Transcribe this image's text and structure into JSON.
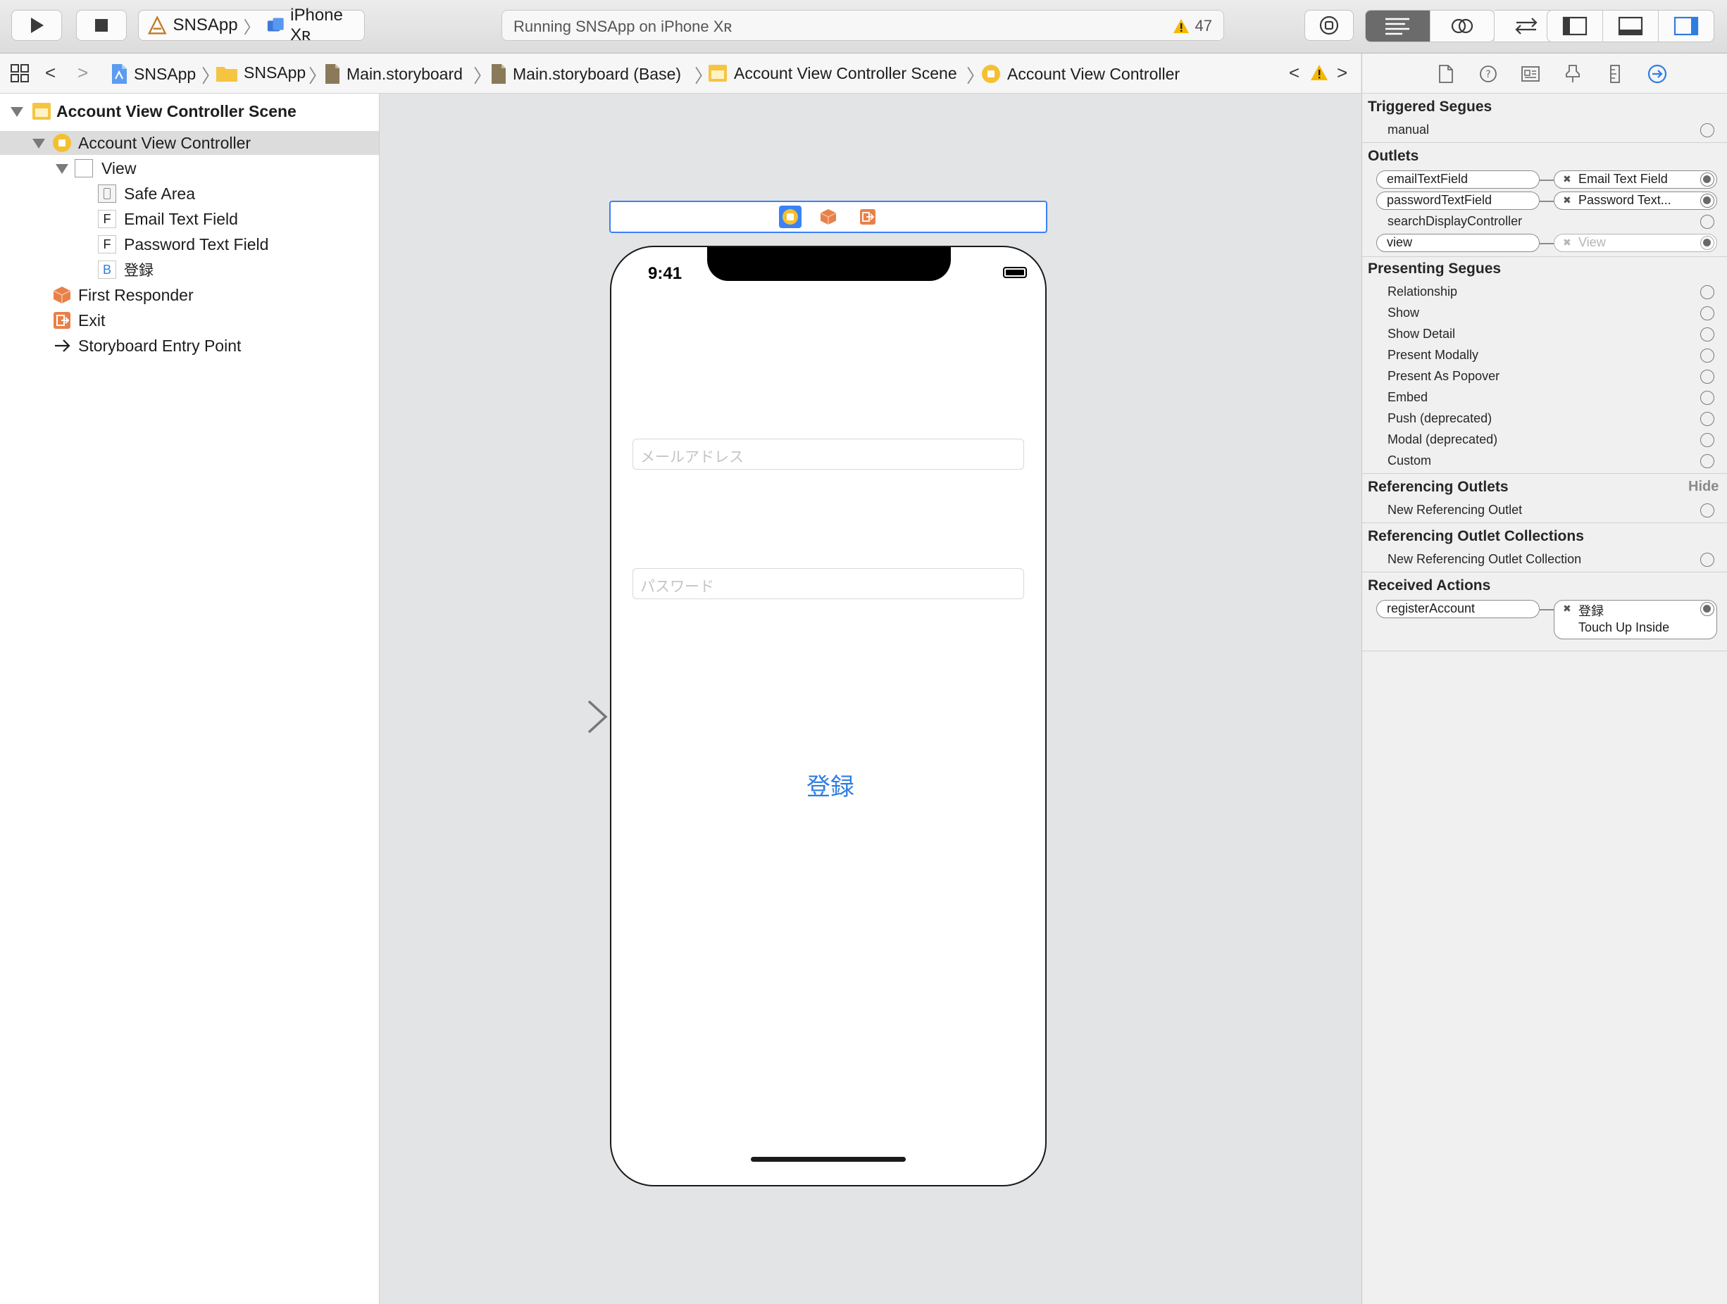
{
  "toolbar": {
    "scheme_app": "SNSApp",
    "scheme_device": "iPhone Xʀ",
    "status_text": "Running SNSApp on iPhone Xʀ",
    "warning_count": "47"
  },
  "jumpbar": {
    "items": [
      "SNSApp",
      "SNSApp",
      "Main.storyboard",
      "Main.storyboard (Base)",
      "Account View Controller Scene",
      "Account View Controller"
    ]
  },
  "outline": {
    "scene": "Account View Controller Scene",
    "controller": "Account View Controller",
    "view": "View",
    "safe_area": "Safe Area",
    "email_field": "Email Text Field",
    "password_field": "Password Text Field",
    "button": "登録",
    "first_responder": "First Responder",
    "exit": "Exit",
    "entry_point": "Storyboard Entry Point",
    "icon_f": "F",
    "icon_b": "B"
  },
  "device": {
    "time": "9:41",
    "email_placeholder": "メールアドレス",
    "password_placeholder": "パスワード",
    "button_label": "登録"
  },
  "inspector": {
    "triggered_segues": {
      "title": "Triggered Segues",
      "items": [
        "manual"
      ]
    },
    "outlets": {
      "title": "Outlets",
      "items": [
        {
          "name": "emailTextField",
          "target": "Email Text Field"
        },
        {
          "name": "passwordTextField",
          "target": "Password Text..."
        },
        {
          "name": "searchDisplayController",
          "target": ""
        },
        {
          "name": "view",
          "target": "View"
        }
      ]
    },
    "presenting_segues": {
      "title": "Presenting Segues",
      "items": [
        "Relationship",
        "Show",
        "Show Detail",
        "Present Modally",
        "Present As Popover",
        "Embed",
        "Push (deprecated)",
        "Modal (deprecated)",
        "Custom"
      ]
    },
    "referencing_outlets": {
      "title": "Referencing Outlets",
      "hide": "Hide",
      "items": [
        "New Referencing Outlet"
      ]
    },
    "referencing_outlet_collections": {
      "title": "Referencing Outlet Collections",
      "items": [
        "New Referencing Outlet Collection"
      ]
    },
    "received_actions": {
      "title": "Received Actions",
      "action": "registerAccount",
      "target": "登録",
      "event": "Touch Up Inside"
    }
  },
  "colors": {
    "accent": "#2f7de1",
    "selection_blue": "#3a82f6",
    "warning": "#f5b800",
    "storyboard_orange": "#e8804a",
    "controller_yellow": "#f5c02f"
  }
}
